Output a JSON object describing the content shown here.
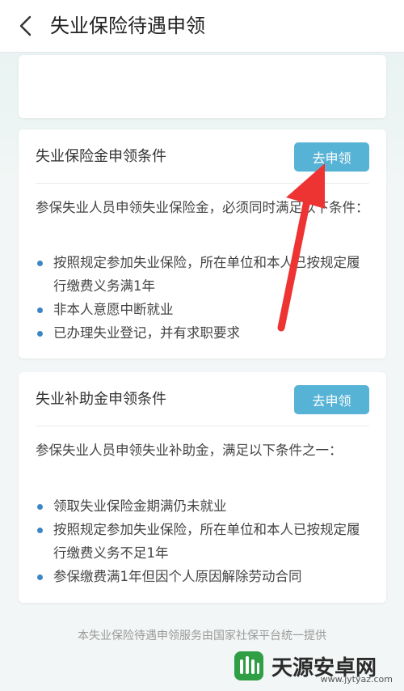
{
  "header": {
    "title": "失业保险待遇申领"
  },
  "cards": [
    {
      "title": "失业保险金申领条件",
      "button": "去申领",
      "description": "参保失业人员申领失业保险金，必须同时满足以下条件：",
      "conditions": [
        "按照规定参加失业保险，所在单位和本人已按规定履行缴费义务满1年",
        "非本人意愿中断就业",
        "已办理失业登记，并有求职要求"
      ]
    },
    {
      "title": "失业补助金申领条件",
      "button": "去申领",
      "description": "参保失业人员申领失业补助金，满足以下条件之一：",
      "conditions": [
        "领取失业保险金期满仍未就业",
        "按照规定参加失业保险，所在单位和本人已按规定履行缴费义务不足1年",
        "参保缴费满1年但因个人原因解除劳动合同"
      ]
    }
  ],
  "footer": "本失业保险待遇申领服务由国家社保平台统一提供",
  "watermark": {
    "text": "天源安卓网",
    "url": "www.jytyaz.com"
  },
  "colors": {
    "button": "#57b3d5",
    "bullet": "#3d86c6",
    "arrow": "#ee3333"
  },
  "icons": {
    "back": "chevron-left-icon",
    "watermark_logo": "android-logo-icon"
  }
}
